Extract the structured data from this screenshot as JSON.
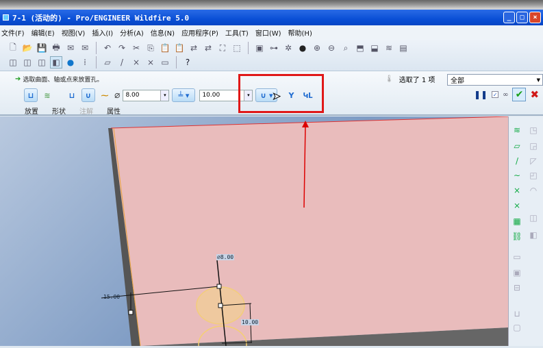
{
  "window": {
    "title": "7-1 (活动的) - Pro/ENGINEER Wildfire 5.0",
    "min": "_",
    "max": "□",
    "close": "×"
  },
  "menu": [
    "文件(F)",
    "编辑(E)",
    "视图(V)",
    "插入(I)",
    "分析(A)",
    "信息(N)",
    "应用程序(P)",
    "工具(T)",
    "窗口(W)",
    "帮助(H)"
  ],
  "dashboard": {
    "prompt": "选取曲面、轴或点来放置孔。",
    "diameter_symbol": "⌀",
    "diameter": "8.00",
    "depth": "10.00",
    "tabs": [
      "放置",
      "形状",
      "注解",
      "属性"
    ],
    "selection_status": "选取了 1 项",
    "filter": "全部"
  },
  "dimensions": {
    "diameter": "⌀8.00",
    "offset": "15.00",
    "depth": "10.00"
  },
  "colors": {
    "title": "#0a4fd6",
    "plane": "#e9bcbc",
    "highlight": "#e01818"
  }
}
